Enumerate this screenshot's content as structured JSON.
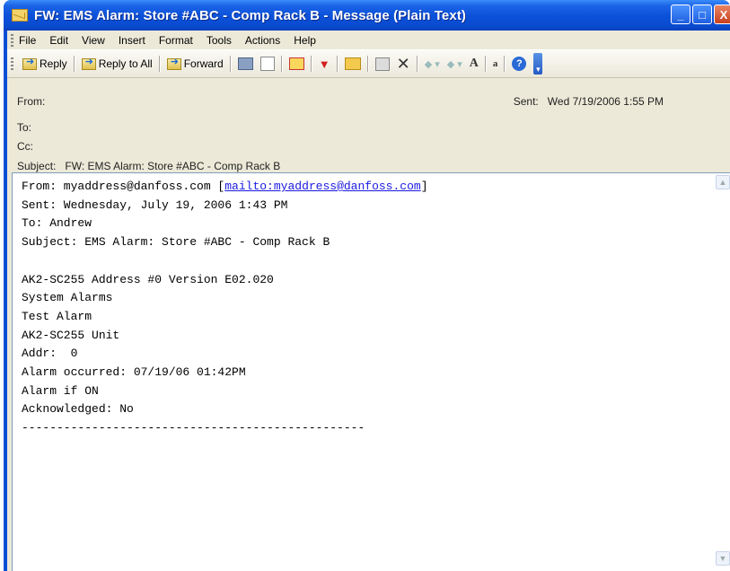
{
  "window": {
    "title": "FW: EMS Alarm: Store #ABC - Comp Rack B - Message (Plain Text)",
    "controls": {
      "minimize": "_",
      "maximize": "□",
      "close": "X"
    }
  },
  "menu": [
    "File",
    "Edit",
    "View",
    "Insert",
    "Format",
    "Tools",
    "Actions",
    "Help"
  ],
  "toolbar": {
    "reply": "Reply",
    "reply_all": "Reply to All",
    "forward": "Forward",
    "icons": [
      "reply-icon",
      "reply-all-icon",
      "forward-icon",
      "print-icon",
      "copy-icon",
      "mark-icon",
      "flag-icon",
      "move-to-folder-icon",
      "rules-icon",
      "delete-icon",
      "previous-item-icon",
      "next-item-icon",
      "font-size-icon",
      "encoding-icon",
      "help-icon"
    ]
  },
  "header": {
    "from_label": "From:",
    "sent_label": "Sent:",
    "sent_value": "Wed 7/19/2006 1:55 PM",
    "to_label": "To:",
    "cc_label": "Cc:",
    "subject_label": "Subject:",
    "subject_value": "FW: EMS Alarm: Store #ABC - Comp Rack B"
  },
  "body": {
    "from_prefix": "From: myaddress@danfoss.com [",
    "from_link": "mailto:myaddress@danfoss.com",
    "from_suffix": "]",
    "lines": [
      "Sent: Wednesday, July 19, 2006 1:43 PM",
      "To: Andrew",
      "Subject: EMS Alarm: Store #ABC - Comp Rack B",
      "",
      "AK2-SC255 Address #0 Version E02.020",
      "System Alarms",
      "Test Alarm",
      "AK2-SC255 Unit",
      "Addr:  0",
      "Alarm occurred: 07/19/06 01:42PM",
      "Alarm if ON",
      "Acknowledged: No",
      "-------------------------------------------------"
    ]
  },
  "colors": {
    "titlebar": "#0a4fd6",
    "chrome": "#ece9d8",
    "link": "#1a1ae0"
  }
}
